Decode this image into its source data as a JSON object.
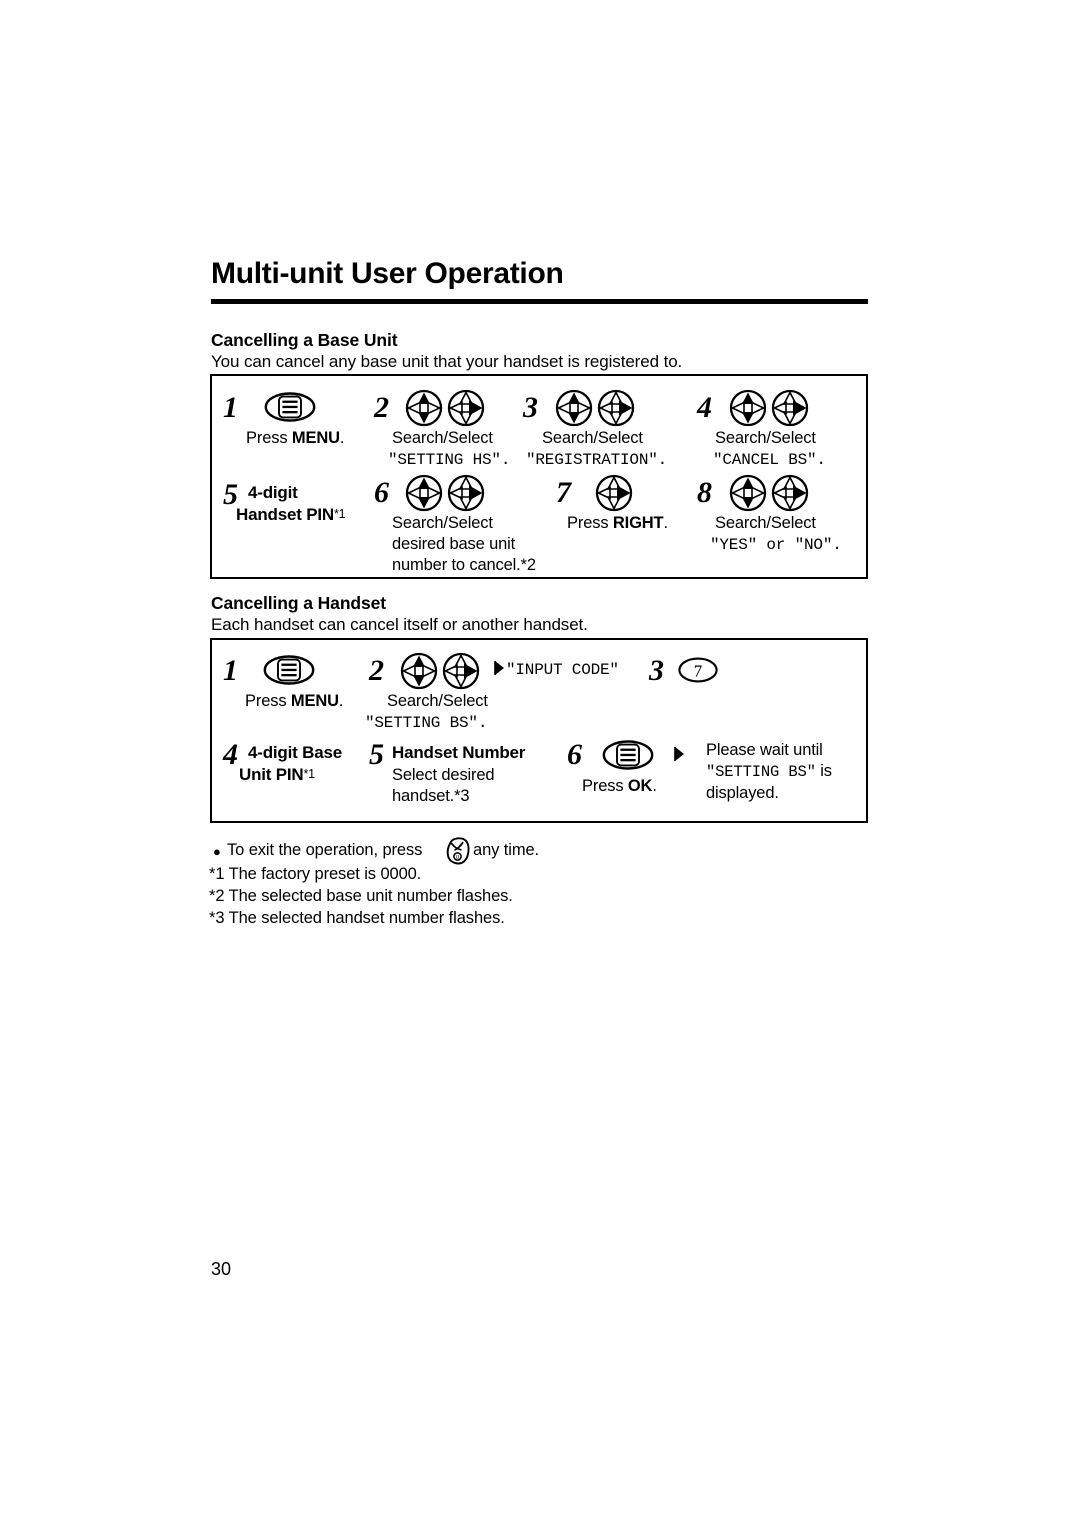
{
  "page": {
    "title": "Multi-unit User Operation",
    "number": "30"
  },
  "sections": [
    {
      "heading": "Cancelling a Base Unit",
      "subtitle": "You can cancel any base unit that your handset is registered to.",
      "steps": [
        {
          "num": "1",
          "icon": "menu-key-icon",
          "caption_plain": "Press ",
          "caption_bold": "MENU",
          "caption_tail": "."
        },
        {
          "num": "2",
          "icon": "navigator-updown-icon,navigator-right-icon",
          "caption": "Search/Select",
          "lcd": "\"SETTING HS\"."
        },
        {
          "num": "3",
          "icon": "navigator-updown-icon,navigator-right-icon",
          "caption": "Search/Select",
          "lcd": "\"REGISTRATION\"."
        },
        {
          "num": "4",
          "icon": "navigator-updown-icon,navigator-right-icon",
          "caption": "Search/Select",
          "lcd": "\"CANCEL BS\"."
        },
        {
          "num": "5",
          "bold_line1": "4-digit",
          "bold_line2": "Handset PIN",
          "bold_sup": "*1"
        },
        {
          "num": "6",
          "icon": "navigator-updown-icon,navigator-right-icon",
          "caption_line1": "Search/Select",
          "caption_line2": "desired base unit",
          "caption_line3": "number to cancel.*2"
        },
        {
          "num": "7",
          "icon": "navigator-right-icon",
          "caption_plain": "Press ",
          "caption_bold": "RIGHT",
          "caption_tail": "."
        },
        {
          "num": "8",
          "icon": "navigator-updown-icon,navigator-right-icon",
          "caption": "Search/Select",
          "lcd": "\"YES\" or \"NO\"."
        }
      ]
    },
    {
      "heading": "Cancelling a Handset",
      "subtitle": "Each handset can cancel itself or another handset.",
      "steps": [
        {
          "num": "1",
          "icon": "menu-key-icon",
          "caption_plain": "Press ",
          "caption_bold": "MENU",
          "caption_tail": "."
        },
        {
          "num": "2",
          "icon": "navigator-updown-icon,navigator-right-icon",
          "caption": "Search/Select",
          "lcd": "\"SETTING BS\"."
        },
        {
          "arrow_lcd": "\"INPUT CODE\""
        },
        {
          "num": "3",
          "icon": "keypad-7-key-icon"
        },
        {
          "num": "4",
          "bold_line1": "4-digit Base",
          "bold_line2": "Unit PIN",
          "bold_sup": "*1"
        },
        {
          "num": "5",
          "bold_line1": "Handset Number",
          "caption_line2": "Select desired",
          "caption_line3": "handset.*3"
        },
        {
          "num": "6",
          "icon": "menu-key-icon",
          "caption_plain": "Press ",
          "caption_bold": "OK",
          "caption_tail": "."
        },
        {
          "wait_line1": "Please wait until",
          "wait_line2_pre": "",
          "wait_lcd": "\"SETTING BS\"",
          "wait_line2_post": " is",
          "wait_line3": "displayed."
        }
      ]
    }
  ],
  "footnotes": {
    "exit_pre": "To exit the operation, press",
    "exit_icon": "power-off-key-icon",
    "exit_post": "any time.",
    "items": [
      "*1 The factory preset is 0000.",
      "*2 The selected base unit number flashes.",
      "*3 The selected handset number flashes."
    ]
  }
}
